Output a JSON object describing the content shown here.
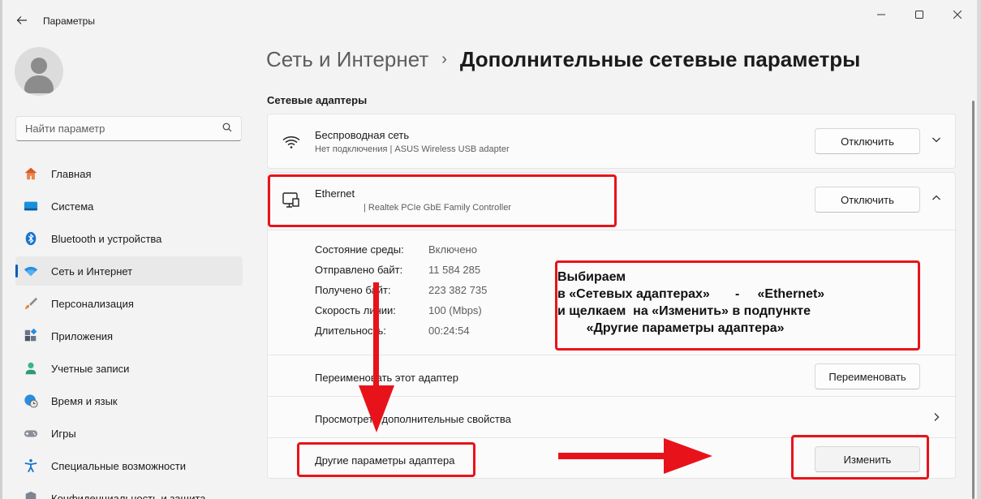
{
  "window": {
    "title": "Параметры"
  },
  "search": {
    "placeholder": "Найти параметр"
  },
  "sidebar": {
    "items": [
      {
        "label": "Главная",
        "icon": "home-icon"
      },
      {
        "label": "Система",
        "icon": "system-icon"
      },
      {
        "label": "Bluetooth и устройства",
        "icon": "bluetooth-icon"
      },
      {
        "label": "Сеть и Интернет",
        "icon": "network-icon",
        "active": true
      },
      {
        "label": "Персонализация",
        "icon": "brush-icon"
      },
      {
        "label": "Приложения",
        "icon": "apps-icon"
      },
      {
        "label": "Учетные записи",
        "icon": "account-icon"
      },
      {
        "label": "Время и язык",
        "icon": "globe-clock-icon"
      },
      {
        "label": "Игры",
        "icon": "gamepad-icon"
      },
      {
        "label": "Специальные возможности",
        "icon": "accessibility-icon"
      },
      {
        "label": "Конфиденциальность и защита",
        "icon": "shield-icon"
      }
    ]
  },
  "breadcrumb": {
    "parent": "Сеть и Интернет",
    "separator": "›",
    "current": "Дополнительные сетевые параметры"
  },
  "section": {
    "title": "Сетевые адаптеры"
  },
  "wifi": {
    "name": "Беспроводная сеть",
    "subtitle": "Нет подключения | ASUS Wireless USB adapter",
    "disable_label": "Отключить"
  },
  "ethernet": {
    "name": "Ethernet",
    "subtitle": "| Realtek PCIe GbE Family Controller",
    "disable_label": "Отключить",
    "properties": [
      {
        "label": "Состояние среды:",
        "value": "Включено"
      },
      {
        "label": "Отправлено байт:",
        "value": "11 584 285"
      },
      {
        "label": "Получено байт:",
        "value": "223 382 735"
      },
      {
        "label": "Скорость линии:",
        "value": "100 (Mbps)"
      },
      {
        "label": "Длительность:",
        "value": "00:24:54"
      }
    ],
    "rename_label": "Переименовать этот адаптер",
    "rename_button": "Переименовать",
    "more_props_label": "Просмотреть дополнительные свойства",
    "other_params_label": "Другие параметры адаптера",
    "edit_button": "Изменить"
  },
  "annotation": {
    "text": "Выбираем\nв «Сетевых адаптерах»       -     «Ethernet»\nи щелкаем  на «Изменить» в подпункте\n        «Другие параметры адаптера»"
  },
  "colors": {
    "accent": "#005fb8",
    "annotation_red": "#e8131a"
  }
}
